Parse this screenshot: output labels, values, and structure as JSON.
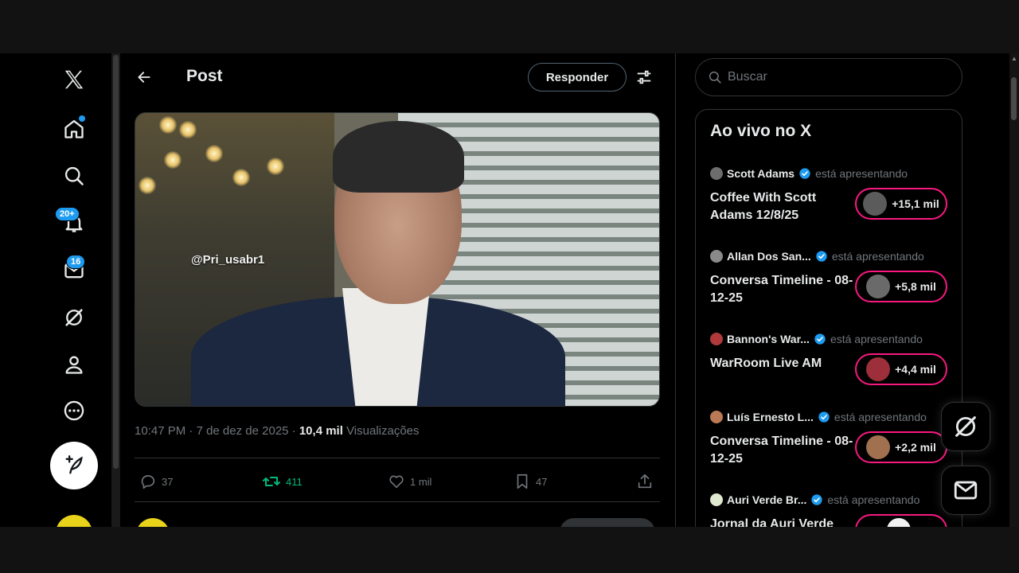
{
  "header": {
    "title": "Post",
    "reply_label": "Responder"
  },
  "nav": {
    "notifications_badge": "20+",
    "messages_badge": "16"
  },
  "video": {
    "watermark": "@Pri_usabr1"
  },
  "post_meta": {
    "time": "10:47 PM",
    "separator": "·",
    "date": "7 de dez de 2025",
    "views_count": "10,4 mil",
    "views_label": "Visualizações"
  },
  "actions": {
    "replies": "37",
    "reposts": "411",
    "likes": "1 mil",
    "bookmarks": "47"
  },
  "search": {
    "placeholder": "Buscar"
  },
  "live": {
    "title": "Ao vivo no X",
    "items": [
      {
        "host": "Scott Adams",
        "status": "está apresentando",
        "title": "Coffee With Scott Adams 12/8/25",
        "listeners": "+15,1 mil"
      },
      {
        "host": "Allan Dos San...",
        "status": "está apresentando",
        "title": "Conversa Timeline - 08-12-25",
        "listeners": "+5,8 mil"
      },
      {
        "host": "Bannon's War...",
        "status": "está apresentando",
        "title": "WarRoom Live AM",
        "listeners": "+4,4 mil"
      },
      {
        "host": "Luís Ernesto L...",
        "status": "está apresentando",
        "title": "Conversa Timeline - 08-12-25",
        "listeners": "+2,2 mil"
      },
      {
        "host": "Auri Verde Br...",
        "status": "está apresentando",
        "title": "Jornal da Auri Verde",
        "listeners": ""
      }
    ]
  },
  "colors": {
    "accent": "#1d9bf0",
    "repost_active": "#00ba7c",
    "live_pink": "#f91880",
    "background": "#000000"
  }
}
